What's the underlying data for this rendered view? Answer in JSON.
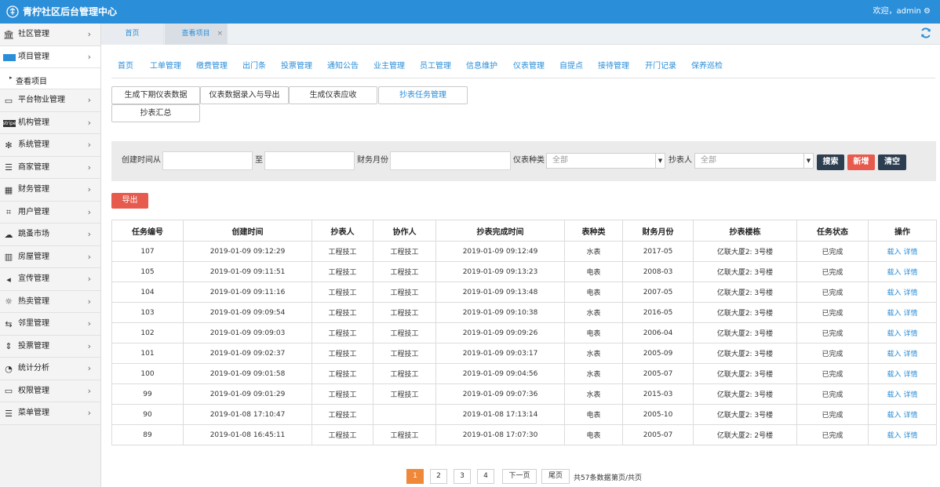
{
  "app": {
    "title": "青柠社区后台管理中心",
    "welcome": "欢迎，admin ⚙"
  },
  "sidebar": {
    "items": [
      {
        "label": "社区管理",
        "icon": "bank-icon"
      },
      {
        "label": "项目管理",
        "icon": "project-icon"
      },
      {
        "label": "平台物业管理",
        "icon": "monitor-icon"
      },
      {
        "label": "机构管理",
        "icon": "stripe-icon"
      },
      {
        "label": "系统管理",
        "icon": "fan-icon"
      },
      {
        "label": "商家管理",
        "icon": "bars-icon"
      },
      {
        "label": "财务管理",
        "icon": "calculator-icon"
      },
      {
        "label": "用户管理",
        "icon": "crop-icon"
      },
      {
        "label": "跳蚤市场",
        "icon": "cloud-icon"
      },
      {
        "label": "房屋管理",
        "icon": "building-icon"
      },
      {
        "label": "宣传管理",
        "icon": "volume-icon"
      },
      {
        "label": "热卖管理",
        "icon": "sun-icon"
      },
      {
        "label": "邻里管理",
        "icon": "retweet-icon"
      },
      {
        "label": "投票管理",
        "icon": "sort-icon"
      },
      {
        "label": "统计分析",
        "icon": "pie-chart-icon"
      },
      {
        "label": "权限管理",
        "icon": "desktop-icon"
      },
      {
        "label": "菜单管理",
        "icon": "list-icon"
      }
    ],
    "sub_item": "查看项目"
  },
  "tabs": {
    "home": "首页",
    "view": "查看项目",
    "close": "×"
  },
  "modules": [
    "首页",
    "工单管理",
    "缴费管理",
    "出门条",
    "投票管理",
    "通知公告",
    "业主管理",
    "员工管理",
    "信息维护",
    "仪表管理",
    "自提点",
    "接待管理",
    "开门记录",
    "保养巡检"
  ],
  "subbuttons": [
    "生成下期仪表数据",
    "仪表数据录入与导出",
    "生成仪表应收",
    "抄表任务管理",
    "抄表汇总"
  ],
  "filter": {
    "created_from": "创建时间从",
    "to": "至",
    "finance_month": "财务月份",
    "meter_type": "仪表种类",
    "meter_type_value": "全部",
    "reader": "抄表人",
    "reader_value": "全部",
    "search": "搜索",
    "add": "新增",
    "clear": "清空"
  },
  "export_label": "导出",
  "table": {
    "headers": [
      "任务编号",
      "创建时间",
      "抄表人",
      "协作人",
      "抄表完成时间",
      "表种类",
      "财务月份",
      "抄表楼栋",
      "任务状态",
      "操作"
    ],
    "rows": [
      [
        "107",
        "2019-01-09 09:12:29",
        "工程技工",
        "工程技工",
        "2019-01-09 09:12:49",
        "水表",
        "2017-05",
        "亿联大厦2: 3号楼",
        "已完成"
      ],
      [
        "105",
        "2019-01-09 09:11:51",
        "工程技工",
        "工程技工",
        "2019-01-09 09:13:23",
        "电表",
        "2008-03",
        "亿联大厦2: 3号楼",
        "已完成"
      ],
      [
        "104",
        "2019-01-09 09:11:16",
        "工程技工",
        "工程技工",
        "2019-01-09 09:13:48",
        "电表",
        "2007-05",
        "亿联大厦2: 3号楼",
        "已完成"
      ],
      [
        "103",
        "2019-01-09 09:09:54",
        "工程技工",
        "工程技工",
        "2019-01-09 09:10:38",
        "水表",
        "2016-05",
        "亿联大厦2: 3号楼",
        "已完成"
      ],
      [
        "102",
        "2019-01-09 09:09:03",
        "工程技工",
        "工程技工",
        "2019-01-09 09:09:26",
        "电表",
        "2006-04",
        "亿联大厦2: 3号楼",
        "已完成"
      ],
      [
        "101",
        "2019-01-09 09:02:37",
        "工程技工",
        "工程技工",
        "2019-01-09 09:03:17",
        "水表",
        "2005-09",
        "亿联大厦2: 3号楼",
        "已完成"
      ],
      [
        "100",
        "2019-01-09 09:01:58",
        "工程技工",
        "工程技工",
        "2019-01-09 09:04:56",
        "水表",
        "2005-07",
        "亿联大厦2: 3号楼",
        "已完成"
      ],
      [
        "99",
        "2019-01-09 09:01:29",
        "工程技工",
        "工程技工",
        "2019-01-09 09:07:36",
        "水表",
        "2015-03",
        "亿联大厦2: 3号楼",
        "已完成"
      ],
      [
        "90",
        "2019-01-08 17:10:47",
        "工程技工",
        "",
        "2019-01-08 17:13:14",
        "电表",
        "2005-10",
        "亿联大厦2: 3号楼",
        "已完成"
      ],
      [
        "89",
        "2019-01-08 16:45:11",
        "工程技工",
        "工程技工",
        "2019-01-08 17:07:30",
        "电表",
        "2005-07",
        "亿联大厦2: 2号楼",
        "已完成"
      ]
    ],
    "action_load": "载入",
    "action_detail": "详情"
  },
  "pagination": {
    "pages": [
      "1",
      "2",
      "3",
      "4"
    ],
    "next": "下一页",
    "last": "尾页",
    "total": "共57条数据",
    "page_info": "第页/共页"
  },
  "colors": {
    "brand": "#2b8ed8",
    "danger": "#e75b4e",
    "dark": "#2c3e50",
    "pager_active": "#f0883a"
  }
}
